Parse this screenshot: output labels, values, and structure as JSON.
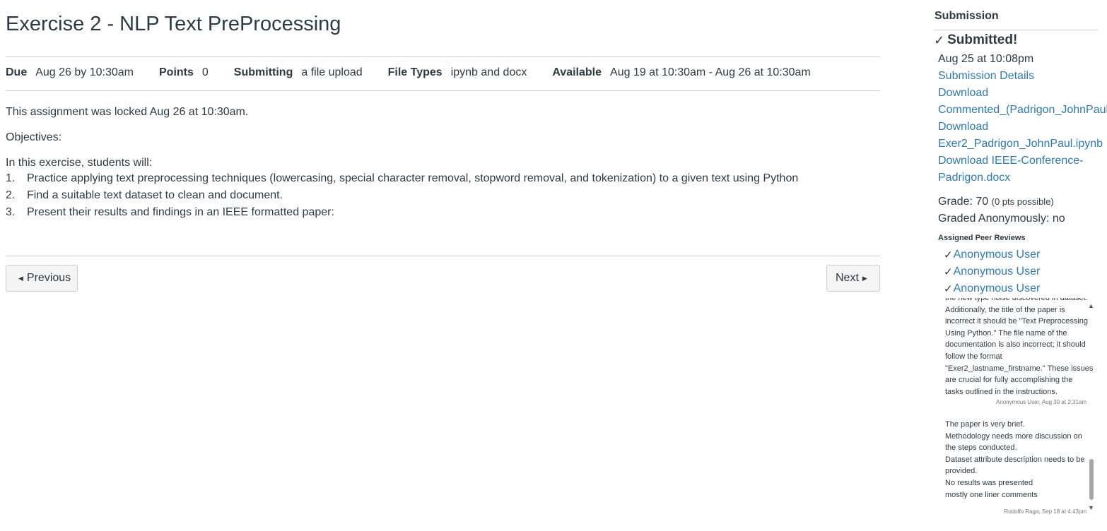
{
  "assignment": {
    "title": "Exercise 2 - NLP Text PreProcessing",
    "details": [
      {
        "label": "Due",
        "value": "Aug 26 by 10:30am"
      },
      {
        "label": "Points",
        "value": "0"
      },
      {
        "label": "Submitting",
        "value": "a file upload"
      },
      {
        "label": "File Types",
        "value": "ipynb and docx"
      },
      {
        "label": "Available",
        "value": "Aug 19 at 10:30am - Aug 26 at 10:30am"
      }
    ],
    "locked_notice": "This assignment was locked Aug 26 at 10:30am.",
    "objectives_label": "Objectives:",
    "intro": "In this exercise, students will:",
    "items": [
      {
        "num": "1.",
        "text": "Practice applying text preprocessing techniques (lowercasing, special character removal, stopword removal, and tokenization) to a given text using Python"
      },
      {
        "num": "2.",
        "text": "Find a suitable text dataset to clean and document."
      },
      {
        "num": "3.",
        "text": "Present their results and findings in an IEEE formatted paper:"
      }
    ]
  },
  "nav": {
    "previous_label": "Previous",
    "next_label": "Next"
  },
  "sidebar": {
    "heading": "Submission",
    "status": "Submitted!",
    "submitted_at": "Aug 25 at 10:08pm",
    "details_link": "Submission Details",
    "downloads": [
      "Download",
      "Commented_(Padrigon_JohnPaul)_",
      "Download",
      "Exer2_Padrigon_JohnPaul.ipynb",
      "Download IEEE-Conference-",
      "Padrigon.docx"
    ],
    "grade_label": "Grade: 70",
    "grade_note": "(0 pts possible)",
    "anonymous": "Graded Anonymously: no",
    "peer_heading": "Assigned Peer Reviews",
    "peers": [
      "Anonymous User",
      "Anonymous User",
      "Anonymous User"
    ],
    "comments": [
      {
        "lines": [
          "the new type noise discovered in dataset.",
          "Additionally, the title of the paper is",
          "incorrect it should be \"Text Preprocessing",
          "Using Python.\" The file name of the",
          "documentation is also incorrect; it should",
          "follow the format",
          "\"Exer2_lastname_firstname.\" These issues",
          "are crucial for fully accomplishing the",
          "tasks outlined in the instructions."
        ],
        "meta": "Anonymous User, Aug 30 at 2:31am"
      },
      {
        "lines": [
          "The paper is very brief.",
          "Methodology needs more discussion on",
          "the steps conducted.",
          "Dataset attribute description needs to be",
          "provided.",
          "No results was presented",
          "mostly one liner comments"
        ],
        "meta": "Rodolfo Raga, Sep 18 at 4:43pm"
      }
    ]
  },
  "icons": {
    "check": "check-icon",
    "prev": "caret-left-icon",
    "next": "caret-right-icon"
  },
  "colors": {
    "link": "#2b7abc",
    "text": "#2d3b45",
    "rule": "#c7cdd1"
  }
}
